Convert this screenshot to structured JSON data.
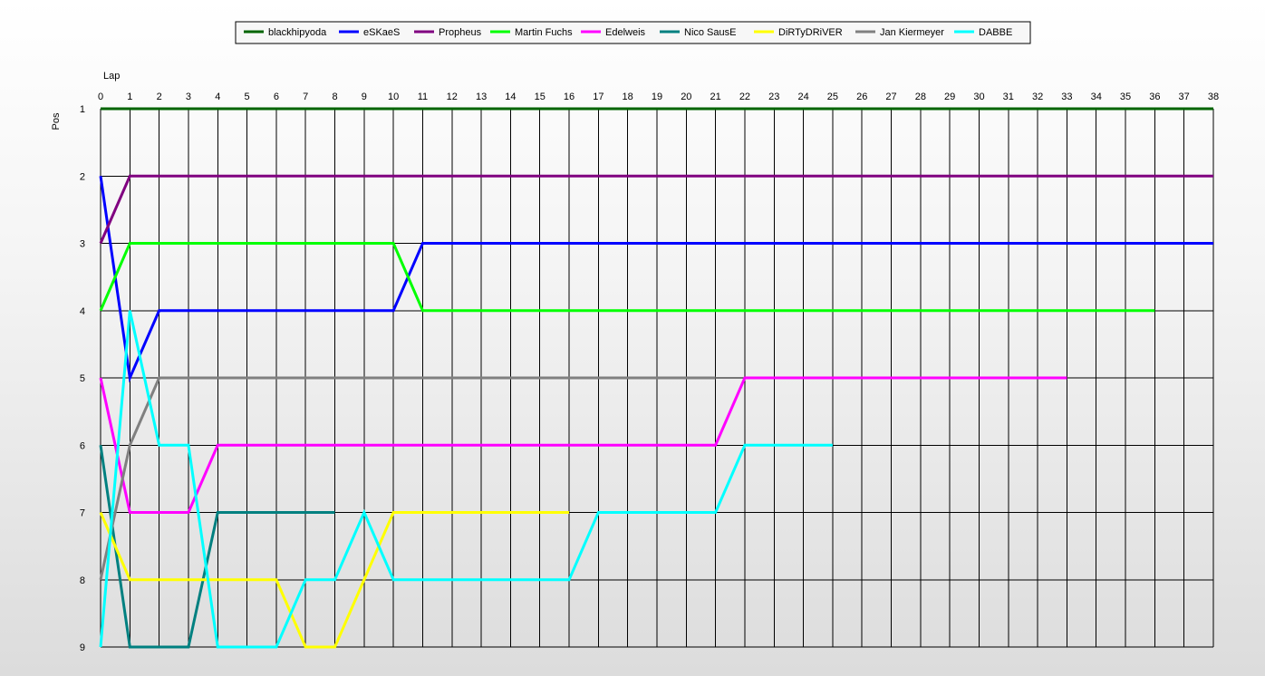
{
  "chart_data": {
    "type": "line",
    "title": "",
    "xlabel": "Lap",
    "ylabel": "Pos",
    "x": [
      0,
      1,
      2,
      3,
      4,
      5,
      6,
      7,
      8,
      9,
      10,
      11,
      12,
      13,
      14,
      15,
      16,
      17,
      18,
      19,
      20,
      21,
      22,
      23,
      24,
      25,
      26,
      27,
      28,
      29,
      30,
      31,
      32,
      33,
      34,
      35,
      36,
      37,
      38
    ],
    "xlim": [
      0,
      38
    ],
    "ylim": [
      1,
      9
    ],
    "y_reversed": true,
    "yticks": [
      1,
      2,
      3,
      4,
      5,
      6,
      7,
      8,
      9
    ],
    "grid": true,
    "legend_position": "top",
    "series": [
      {
        "name": "blackhipyoda",
        "color": "#006400",
        "values": [
          1,
          1,
          1,
          1,
          1,
          1,
          1,
          1,
          1,
          1,
          1,
          1,
          1,
          1,
          1,
          1,
          1,
          1,
          1,
          1,
          1,
          1,
          1,
          1,
          1,
          1,
          1,
          1,
          1,
          1,
          1,
          1,
          1,
          1,
          1,
          1,
          1,
          1,
          1
        ]
      },
      {
        "name": "eSKaeS",
        "color": "#0000ff",
        "values": [
          2,
          5,
          4,
          4,
          4,
          4,
          4,
          4,
          4,
          4,
          4,
          3,
          3,
          3,
          3,
          3,
          3,
          3,
          3,
          3,
          3,
          3,
          3,
          3,
          3,
          3,
          3,
          3,
          3,
          3,
          3,
          3,
          3,
          3,
          3,
          3,
          3,
          3,
          3
        ]
      },
      {
        "name": "Propheus",
        "color": "#800080",
        "values": [
          3,
          2,
          2,
          2,
          2,
          2,
          2,
          2,
          2,
          2,
          2,
          2,
          2,
          2,
          2,
          2,
          2,
          2,
          2,
          2,
          2,
          2,
          2,
          2,
          2,
          2,
          2,
          2,
          2,
          2,
          2,
          2,
          2,
          2,
          2,
          2,
          2,
          2,
          2
        ]
      },
      {
        "name": "Martin Fuchs",
        "color": "#00ff00",
        "values": [
          4,
          3,
          3,
          3,
          3,
          3,
          3,
          3,
          3,
          3,
          3,
          4,
          4,
          4,
          4,
          4,
          4,
          4,
          4,
          4,
          4,
          4,
          4,
          4,
          4,
          4,
          4,
          4,
          4,
          4,
          4,
          4,
          4,
          4,
          4,
          4,
          4
        ]
      },
      {
        "name": "Edelweis",
        "color": "#ff00ff",
        "values": [
          5,
          7,
          7,
          7,
          6,
          6,
          6,
          6,
          6,
          6,
          6,
          6,
          6,
          6,
          6,
          6,
          6,
          6,
          6,
          6,
          6,
          6,
          5,
          5,
          5,
          5,
          5,
          5,
          5,
          5,
          5,
          5,
          5,
          5
        ]
      },
      {
        "name": "Nico SausE",
        "color": "#008080",
        "values": [
          6,
          9,
          9,
          9,
          7,
          7,
          7,
          7,
          7
        ]
      },
      {
        "name": "DiRTyDRiVER",
        "color": "#ffff00",
        "values": [
          7,
          8,
          8,
          8,
          8,
          8,
          8,
          9,
          9,
          8,
          7,
          7,
          7,
          7,
          7,
          7,
          7
        ]
      },
      {
        "name": "Jan Kiermeyer",
        "color": "#808080",
        "values": [
          8,
          6,
          5,
          5,
          5,
          5,
          5,
          5,
          5,
          5,
          5,
          5,
          5,
          5,
          5,
          5,
          5,
          5,
          5,
          5,
          5,
          5
        ]
      },
      {
        "name": "DABBE",
        "color": "#00ffff",
        "values": [
          9,
          4,
          6,
          6,
          9,
          9,
          9,
          8,
          8,
          7,
          8,
          8,
          8,
          8,
          8,
          8,
          8,
          7,
          7,
          7,
          7,
          7,
          6,
          6,
          6,
          6
        ]
      }
    ]
  }
}
